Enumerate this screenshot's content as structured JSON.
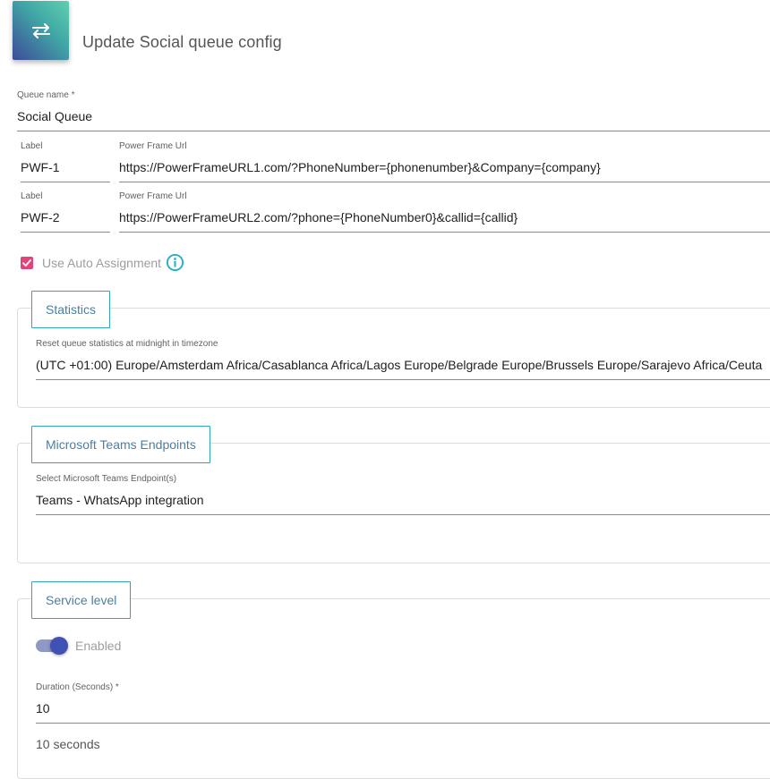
{
  "header": {
    "icon": "swap-arrows-icon",
    "title": "Update Social queue config"
  },
  "queue_name": {
    "label": "Queue name *",
    "value": "Social Queue"
  },
  "power_frames": [
    {
      "label_label": "Label",
      "label_value": "PWF-1",
      "url_label": "Power Frame Url",
      "url_value": "https://PowerFrameURL1.com/?PhoneNumber={phonenumber}&Company={company}"
    },
    {
      "label_label": "Label",
      "label_value": "PWF-2",
      "url_label": "Power Frame Url",
      "url_value": "https://PowerFrameURL2.com/?phone={PhoneNumber0}&callid={callid}"
    }
  ],
  "auto_assignment": {
    "label": "Use Auto Assignment",
    "checked": true,
    "color": "#e2447a",
    "info_icon": "info-icon"
  },
  "statistics": {
    "title": "Statistics",
    "field_label": "Reset queue statistics at midnight in timezone",
    "field_value": "(UTC +01:00) Europe/Amsterdam Africa/Casablanca Africa/Lagos Europe/Belgrade Europe/Brussels Europe/Sarajevo Africa/Ceuta"
  },
  "teams": {
    "title": "Microsoft Teams Endpoints",
    "field_label": "Select Microsoft Teams Endpoint(s)",
    "field_value": "Teams - WhatsApp integration"
  },
  "service_level": {
    "title": "Service level",
    "toggle_label": "Enabled",
    "toggle_on": true,
    "duration_label": "Duration (Seconds) *",
    "duration_value": "10",
    "hint": "10 seconds"
  },
  "colors": {
    "accent_teal": "#2fa4b8",
    "toggle": "#3f51b5"
  }
}
